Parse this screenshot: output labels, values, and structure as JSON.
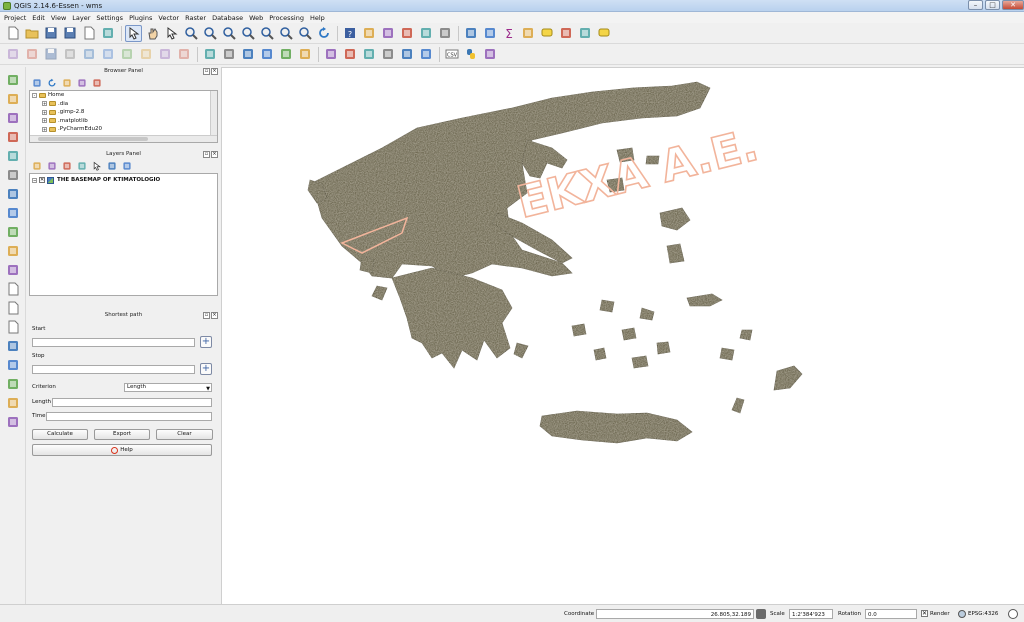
{
  "window": {
    "title": "QGIS 2.14.6-Essen - wms",
    "controls": [
      "minimize",
      "maximize",
      "close"
    ]
  },
  "menubar": [
    "Project",
    "Edit",
    "View",
    "Layer",
    "Settings",
    "Plugins",
    "Vector",
    "Raster",
    "Database",
    "Web",
    "Processing",
    "Help"
  ],
  "toolbar_main": [
    "new-project-icon",
    "open-project-icon",
    "save-project-icon",
    "save-as-icon",
    "new-print-composer-icon",
    "composer-manager-icon",
    "pan-icon",
    "pan-hand-icon",
    "pan-to-selection-icon",
    "zoom-in-icon",
    "zoom-out-icon",
    "zoom-full-icon",
    "zoom-to-selection-icon",
    "zoom-to-layer-icon",
    "zoom-last-icon",
    "zoom-next-icon",
    "refresh-icon",
    "help-icon",
    "identify-icon",
    "run-action-icon",
    "select-icon",
    "select-by-expression-icon",
    "deselect-icon",
    "attribute-table-icon",
    "field-calculator-icon",
    "statistics-icon",
    "measure-icon",
    "map-tips-icon",
    "bookmark-icon",
    "show-bookmarks-icon",
    "text-annotation-icon"
  ],
  "toolbar_digitize": [
    "current-edits-icon",
    "toggle-editing-icon",
    "save-edits-icon",
    "add-feature-icon",
    "move-feature-icon",
    "node-tool-icon",
    "delete-selected-icon",
    "cut-features-icon",
    "copy-features-icon",
    "paste-features-icon",
    "label-icon",
    "pin-labels-icon",
    "show-hide-labels-icon",
    "move-label-icon",
    "rotate-label-icon",
    "change-label-icon",
    "add-vector-icon",
    "add-raster-icon",
    "add-wms-icon",
    "add-wfs-icon",
    "spatialite-icon",
    "mssql-icon",
    "csv-icon",
    "python-console-icon",
    "processing-icon"
  ],
  "vtoolbar": [
    "add-vector-layer-icon",
    "add-raster-layer-icon",
    "add-postgis-icon",
    "add-spatialite-icon",
    "add-mssql-icon",
    "add-oracle-icon",
    "add-wms-layer-icon",
    "add-wcs-layer-icon",
    "add-wfs-layer-icon",
    "add-delimited-text-icon",
    "add-virtual-layer-icon",
    "new-shapefile-icon",
    "new-spatialite-icon",
    "new-gpx-icon",
    "digitize-point-icon",
    "georeferencer-icon",
    "gps-tools-icon",
    "topology-checker-icon",
    "road-graph-icon"
  ],
  "browser_panel": {
    "title": "Browser Panel",
    "tools": [
      "add-selected-icon",
      "refresh-browser-icon",
      "filter-browser-icon",
      "collapse-all-icon",
      "properties-icon"
    ],
    "items": [
      {
        "label": "Home",
        "level": 0,
        "expand": "-"
      },
      {
        "label": ".dia",
        "level": 1,
        "expand": "+"
      },
      {
        "label": ".gimp-2.8",
        "level": 1,
        "expand": "+"
      },
      {
        "label": ".matplotlib",
        "level": 1,
        "expand": "+"
      },
      {
        "label": ".PyCharmEdu20",
        "level": 1,
        "expand": "+"
      }
    ]
  },
  "layers_panel": {
    "title": "Layers Panel",
    "tools": [
      "layer-style-icon",
      "add-group-icon",
      "filter-legend-icon",
      "filter-expression-icon",
      "expand-all-icon",
      "collapse-all-layers-icon",
      "remove-layer-icon"
    ],
    "layers": [
      {
        "name": "THE BASEMAP OF KTIMATOLOGIO",
        "checked": true
      }
    ]
  },
  "shortest_path": {
    "title": "Shortest path",
    "start_label": "Start",
    "start_value": "",
    "stop_label": "Stop",
    "stop_value": "",
    "criterion_label": "Criterion",
    "criterion_value": "Length",
    "length_label": "Length",
    "length_value": "",
    "time_label": "Time",
    "time_value": "",
    "calculate": "Calculate",
    "export": "Export",
    "clear": "Clear",
    "help": "Help"
  },
  "map": {
    "watermark": "EKXA A.E.",
    "land_color": "#6f6a52",
    "watermark_color": "#f2b49b"
  },
  "statusbar": {
    "coordinate_label": "Coordinate",
    "coordinate_value": "26.805,32.189",
    "scale_label": "Scale",
    "scale_value": "1:2'384'923",
    "rotation_label": "Rotation",
    "rotation_value": "0.0",
    "render_label": "Render",
    "render_checked": true,
    "crs": "EPSG:4326"
  }
}
